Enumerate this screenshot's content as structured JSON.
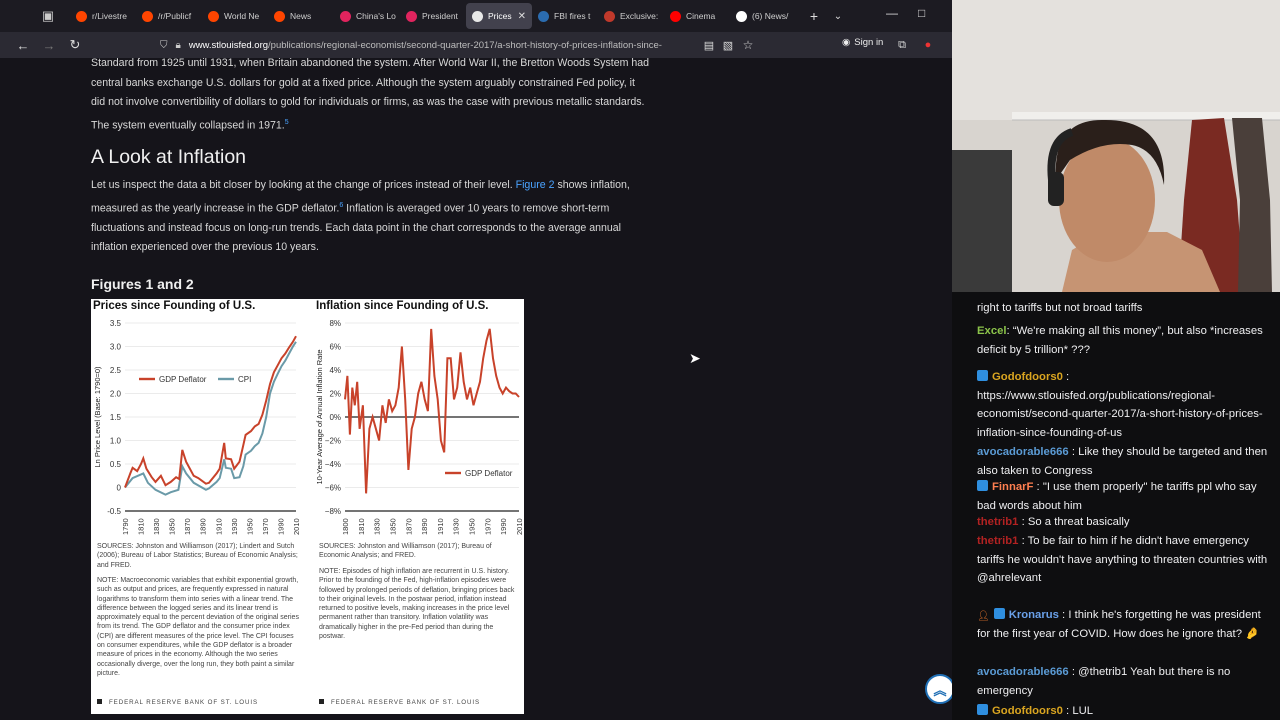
{
  "browser": {
    "tabs": [
      {
        "label": "r/Livestre",
        "color": "#ff4500"
      },
      {
        "label": "/r/Publicf",
        "color": "#ff4500"
      },
      {
        "label": "World Ne",
        "color": "#ff4500"
      },
      {
        "label": "News",
        "color": "#ff4500"
      },
      {
        "label": "China's Lo",
        "color": "#e0245e"
      },
      {
        "label": "President",
        "color": "#e0245e"
      },
      {
        "label": "Prices",
        "color": "#e8e8e8",
        "active": true
      },
      {
        "label": "FBI fires t",
        "color": "#2b6cb0"
      },
      {
        "label": "Exclusive:",
        "color": "#c0392b"
      },
      {
        "label": "Cinema",
        "color": "#ff0000"
      },
      {
        "label": "(6) News/",
        "color": "#ffffff"
      }
    ],
    "url_host": "www.stlouisfed.org",
    "url_path": "/publications/regional-economist/second-quarter-2017/a-short-history-of-prices-inflation-since-",
    "sign_in": "Sign in"
  },
  "article": {
    "intro_para": "Standard from 1925 until 1931, when Britain abandoned the system. After World War II, the Bretton Woods System had central banks exchange U.S. dollars for gold at a fixed price. Although the system arguably constrained Fed policy, it did not involve convertibility of dollars to gold for individuals or firms, as was the case with previous metallic standards. The system eventually collapsed in 1971.",
    "intro_footnote": "5",
    "heading": "A Look at Inflation",
    "body_a": "Let us inspect the data a bit closer by looking at the change of prices instead of their level.",
    "body_link": "Figure 2",
    "body_b": "shows inflation, measured as the yearly increase in the GDP deflator.",
    "body_footnote": "6",
    "body_c": "Inflation is averaged over 10 years to remove short-term fluctuations and instead focus on long-run trends. Each data point in the chart corresponds to the average annual inflation experienced over the previous 10 years.",
    "figures_heading": "Figures 1 and 2"
  },
  "chart_data": [
    {
      "type": "line",
      "title": "Prices since Founding of U.S.",
      "ylabel": "Ln Price Level (Base: 1790=0)",
      "ylim": [
        -0.5,
        3.5
      ],
      "yticks": [
        "3.5",
        "3.0",
        "2.5",
        "2.0",
        "1.5",
        "1.0",
        "0.5",
        "0",
        "-0.5"
      ],
      "xticks": [
        "1790",
        "1810",
        "1830",
        "1850",
        "1870",
        "1890",
        "1910",
        "1930",
        "1950",
        "1970",
        "1990",
        "2010"
      ],
      "legend_position": "middle-left",
      "series": [
        {
          "name": "GDP Deflator",
          "color": "#c8422a",
          "x": [
            1790,
            1797,
            1800,
            1806,
            1811,
            1814,
            1818,
            1825,
            1830,
            1837,
            1843,
            1850,
            1857,
            1861,
            1865,
            1870,
            1880,
            1886,
            1896,
            1900,
            1910,
            1914,
            1920,
            1922,
            1929,
            1933,
            1940,
            1945,
            1948,
            1955,
            1960,
            1965,
            1970,
            1975,
            1980,
            1985,
            1990,
            1995,
            2000,
            2005,
            2010,
            2014
          ],
          "y": [
            0,
            0.3,
            0.42,
            0.35,
            0.5,
            0.62,
            0.4,
            0.22,
            0.12,
            0.25,
            0.05,
            0.12,
            0.22,
            0.18,
            0.8,
            0.55,
            0.25,
            0.2,
            0.08,
            0.1,
            0.3,
            0.4,
            0.95,
            0.62,
            0.6,
            0.4,
            0.55,
            0.9,
            1.12,
            1.2,
            1.3,
            1.35,
            1.55,
            1.85,
            2.2,
            2.45,
            2.6,
            2.75,
            2.85,
            2.98,
            3.1,
            3.22
          ]
        },
        {
          "name": "CPI",
          "color": "#6a9aa8",
          "x": [
            1790,
            1800,
            1814,
            1820,
            1830,
            1843,
            1850,
            1860,
            1865,
            1870,
            1880,
            1896,
            1900,
            1910,
            1914,
            1920,
            1922,
            1929,
            1933,
            1940,
            1945,
            1948,
            1955,
            1960,
            1965,
            1970,
            1975,
            1980,
            1985,
            1990,
            1995,
            2000,
            2005,
            2010,
            2014
          ],
          "y": [
            0,
            0.2,
            0.3,
            0.1,
            -0.05,
            -0.15,
            -0.1,
            -0.05,
            0.45,
            0.3,
            0.1,
            -0.05,
            -0.02,
            0.12,
            0.2,
            0.6,
            0.42,
            0.4,
            0.2,
            0.22,
            0.45,
            0.7,
            0.78,
            0.88,
            0.95,
            1.15,
            1.5,
            2.0,
            2.25,
            2.42,
            2.58,
            2.7,
            2.85,
            3.0,
            3.1
          ]
        }
      ],
      "sources": "SOURCES: Johnston and Williamson (2017); Lindert and Sutch (2006); Bureau of Labor Statistics; Bureau of Economic Analysis; and FRED.",
      "note": "NOTE: Macroeconomic variables that exhibit exponential growth, such as output and prices, are frequently expressed in natural logarithms to transform them into series with a linear trend. The difference between the logged series and its linear trend is approximately equal to the percent deviation of the original series from its trend. The GDP deflator and the consumer price index (CPI) are different measures of the price level. The CPI focuses on consumer expenditures, while the GDP deflator is a broader measure of prices in the economy. Although the two series occasionally diverge, over the long run, they both paint a similar picture.",
      "footer": "FEDERAL RESERVE BANK OF ST. LOUIS"
    },
    {
      "type": "line",
      "title": "Inflation since Founding of U.S.",
      "ylabel": "10-Year Average of Annual Inflation Rate",
      "ylim": [
        -8,
        8
      ],
      "yticks": [
        "8%",
        "6%",
        "4%",
        "2%",
        "0%",
        "−2%",
        "−4%",
        "−6%",
        "−8%"
      ],
      "xticks": [
        "1800",
        "1810",
        "1830",
        "1850",
        "1870",
        "1890",
        "1910",
        "1930",
        "1950",
        "1970",
        "1990",
        "2010"
      ],
      "legend_position": "bottom-right",
      "series": [
        {
          "name": "GDP Deflator",
          "color": "#c8422a",
          "x": [
            1800,
            1803,
            1806,
            1809,
            1812,
            1815,
            1818,
            1822,
            1826,
            1830,
            1834,
            1838,
            1842,
            1846,
            1850,
            1854,
            1858,
            1862,
            1866,
            1870,
            1874,
            1878,
            1882,
            1886,
            1890,
            1894,
            1898,
            1902,
            1906,
            1910,
            1914,
            1918,
            1922,
            1926,
            1930,
            1934,
            1938,
            1942,
            1946,
            1950,
            1954,
            1958,
            1962,
            1966,
            1970,
            1974,
            1978,
            1982,
            1986,
            1990,
            1994,
            1998,
            2002,
            2006,
            2010,
            2014
          ],
          "y": [
            1.5,
            3.5,
            -1.5,
            2.5,
            1,
            3,
            -1,
            1,
            -6.5,
            -1,
            0,
            -1,
            -2,
            1,
            -0.5,
            1.5,
            0.5,
            1,
            2.5,
            6,
            1.5,
            -4.5,
            -1,
            0,
            2,
            3,
            1.5,
            0.5,
            7.5,
            3.5,
            1.5,
            -2,
            -3,
            5,
            5,
            1.5,
            2.5,
            5.5,
            3,
            1.5,
            2.5,
            1,
            2,
            3,
            5,
            6.5,
            7.5,
            5,
            3.5,
            2.5,
            2,
            2.5,
            2.2,
            2,
            2,
            1.7
          ]
        }
      ],
      "sources": "SOURCES: Johnston and Williamson (2017); Bureau of Economic Analysis; and FRED.",
      "note": "NOTE: Episodes of high inflation are recurrent in U.S. history. Prior to the founding of the Fed, high-inflation episodes were followed by prolonged periods of deflation, bringing prices back to their original levels. In the postwar period, inflation instead returned to positive levels, making increases in the price level permanent rather than transitory. Inflation volatility was dramatically higher in the pre-Fed period than during the postwar.",
      "footer": "FEDERAL RESERVE BANK OF ST. LOUIS"
    }
  ],
  "chat": {
    "partial_top": "right to tariffs but not broad tariffs",
    "messages": [
      {
        "user": "Excel",
        "color": "#8bc34a",
        "text": ": “We're making all this money”, but also *increases deficit by 5 trillion* ???",
        "badge": ""
      },
      {
        "user": "Godofdoors0",
        "color": "#daa520",
        "text": " : https://www.stlouisfed.org/publications/regional-economist/second-quarter-2017/a-short-history-of-prices-inflation-since-founding-of-us",
        "badge": "blue"
      },
      {
        "user": "avocadorable666",
        "color": "#5b9bd5",
        "text": " : Like they should be targeted and then also taken to Congress",
        "badge": ""
      },
      {
        "user": "FinnarF",
        "color": "#ff7f50",
        "text": " : \"I use them properly\" he tariffs ppl who say bad words about him",
        "badge": "blue"
      },
      {
        "user": "thetrib1",
        "color": "#b22222",
        "text": " : So a threat basically",
        "badge": ""
      },
      {
        "user": "thetrib1",
        "color": "#b22222",
        "text": " : To be fair to him if he didn't have emergency tariffs he wouldn't have anything to threaten countries with @ahrelevant",
        "badge": ""
      },
      {
        "user": "Kronarus",
        "color": "#6aa0e8",
        "text": " : I think he's forgetting he was president for the first year of COVID. How does he ignore that? 🤌",
        "badge": "both"
      },
      {
        "user": "avocadorable666",
        "color": "#5b9bd5",
        "text": " : @thetrib1 Yeah but there is no emergency",
        "badge": ""
      },
      {
        "user": "Godofdoors0",
        "color": "#daa520",
        "text": " : LUL",
        "badge": "blue"
      }
    ]
  }
}
